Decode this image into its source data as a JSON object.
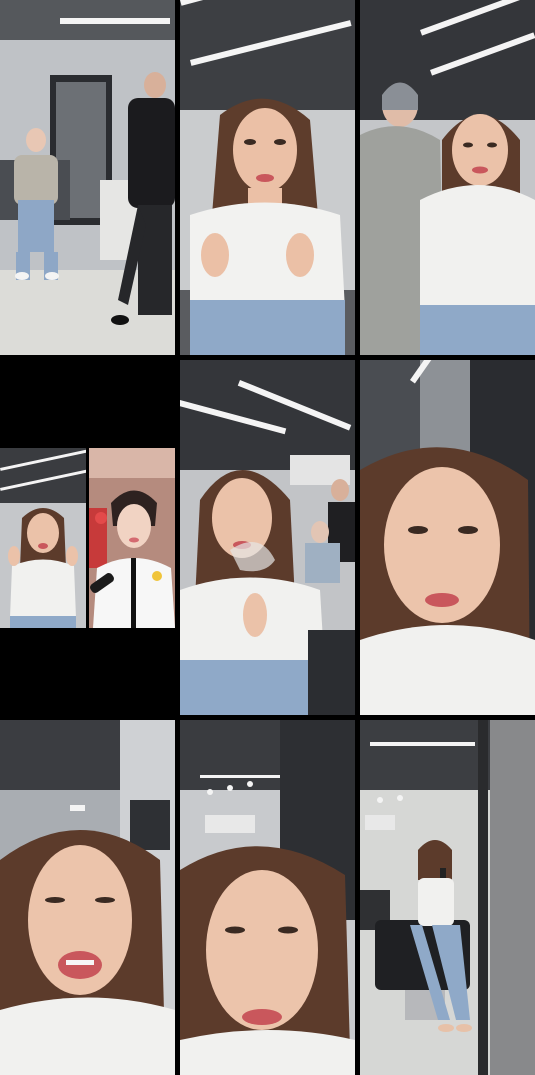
{
  "layout": {
    "columns": 3,
    "rows": 3
  },
  "tiles": [
    {
      "id": 1,
      "scene": "salon-wide",
      "people": 2
    },
    {
      "id": 2,
      "scene": "woman-hands-up",
      "people": 1
    },
    {
      "id": 3,
      "scene": "two-women",
      "people": 2
    },
    {
      "id": 4,
      "scene": "split-duet",
      "people": 2
    },
    {
      "id": 5,
      "scene": "woman-smoke",
      "people": 3
    },
    {
      "id": 6,
      "scene": "woman-closeup",
      "people": 1
    },
    {
      "id": 7,
      "scene": "woman-singing",
      "people": 1
    },
    {
      "id": 8,
      "scene": "woman-lowangle",
      "people": 1
    },
    {
      "id": 9,
      "scene": "mirror-selfie",
      "people": 1
    }
  ],
  "colors": {
    "divider": "#000000",
    "ceiling": "#3a3c40",
    "wall": "#c9ccd0",
    "floor": "#d8d8d6",
    "skin": "#e9b9a0",
    "hair": "#5a3a2a",
    "shirt": "#f1f1ef",
    "jeans": "#8fa9c8",
    "lips": "#c8525a"
  }
}
